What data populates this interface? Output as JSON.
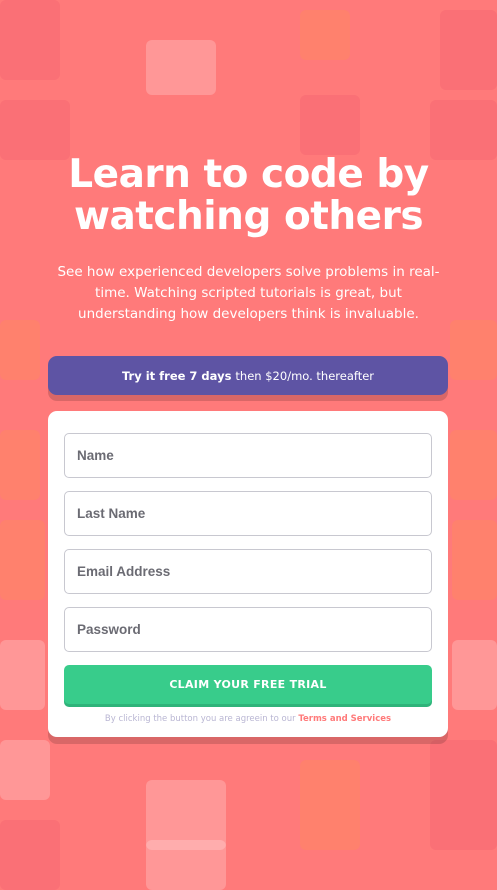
{
  "hero": {
    "title_line1": "Learn to code by",
    "title_line2": "watching others",
    "subtitle": "See how experienced developers solve problems in real-time. Watching scripted tutorials is great, but understanding how developers think is invaluable."
  },
  "promo": {
    "bold": "Try it free 7 days",
    "rest": "then $20/mo. thereafter"
  },
  "form": {
    "fields": [
      {
        "placeholder": "Name"
      },
      {
        "placeholder": "Last Name"
      },
      {
        "placeholder": "Email Address"
      },
      {
        "placeholder": "Password"
      }
    ],
    "cta_label": "CLAIM YOUR FREE TRIAL",
    "legal_prefix": "By clicking the button you are agreein to our",
    "legal_link": "Terms and Services"
  },
  "colors": {
    "background": "#ff7a7a",
    "promo": "#5e54a4",
    "cta": "#38cc8b",
    "link": "#ff7a7a"
  }
}
